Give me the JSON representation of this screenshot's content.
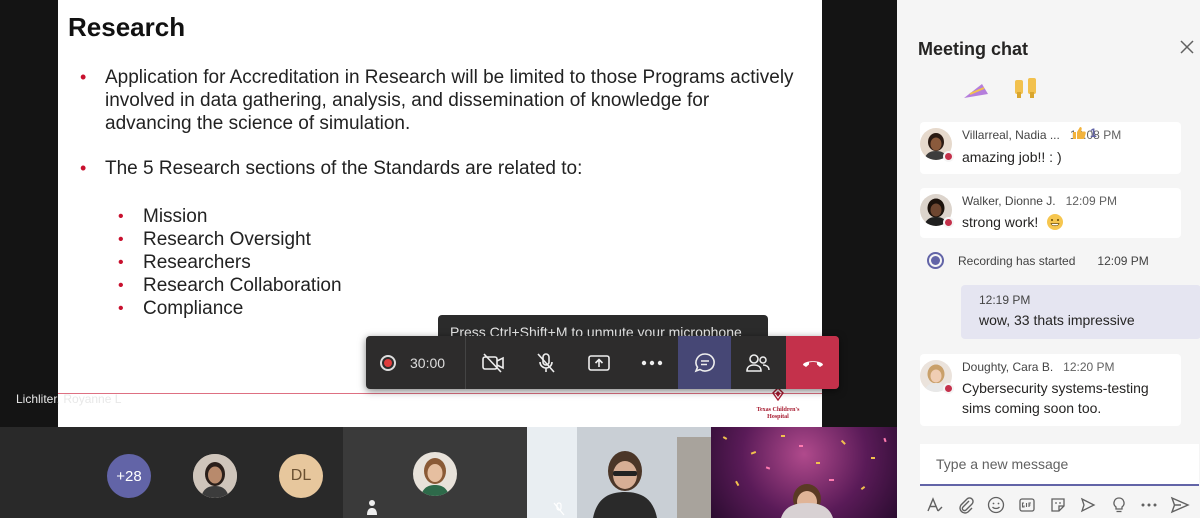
{
  "slide": {
    "title": "Research",
    "bullets": [
      "Application for Accreditation in Research will be limited to those Programs actively involved in data gathering,  analysis, and dissemination of knowledge for advancing the science of simulation.",
      "The 5 Research sections of the Standards are related to:"
    ],
    "sub_bullets": [
      "Mission",
      "Research Oversight",
      "Researchers",
      "Research Collaboration",
      "Compliance"
    ],
    "logo_text": "Texas Children's Hospital"
  },
  "presenter": {
    "name": "Lichliter, Royanne L"
  },
  "tooltip": {
    "text": "Press Ctrl+Shift+M to unmute your microphone"
  },
  "controls": {
    "timer": "30:00"
  },
  "gallery": {
    "more_count": "+28",
    "initials": "DL"
  },
  "chat": {
    "title": "Meeting chat",
    "messages": [
      {
        "sender": "Villarreal, Nadia ...",
        "time": "12:08 PM",
        "text": "amazing job!! : )",
        "reaction_count": "1"
      },
      {
        "sender": "Walker, Dionne J.",
        "time": "12:09 PM",
        "text": "strong work!"
      }
    ],
    "system": {
      "text": "Recording has started",
      "time": "12:09 PM"
    },
    "mine": {
      "time": "12:19 PM",
      "text": "wow, 33 thats impressive"
    },
    "last": {
      "sender": "Doughty, Cara B.",
      "time": "12:20 PM",
      "text_line1": "Cybersecurity systems-testing",
      "text_line2": "sims coming soon too."
    },
    "composer_placeholder": "Type a new message"
  },
  "colors": {
    "accent": "#6264a7",
    "hangup": "#c4314b",
    "bullet_red": "#c8102e"
  }
}
